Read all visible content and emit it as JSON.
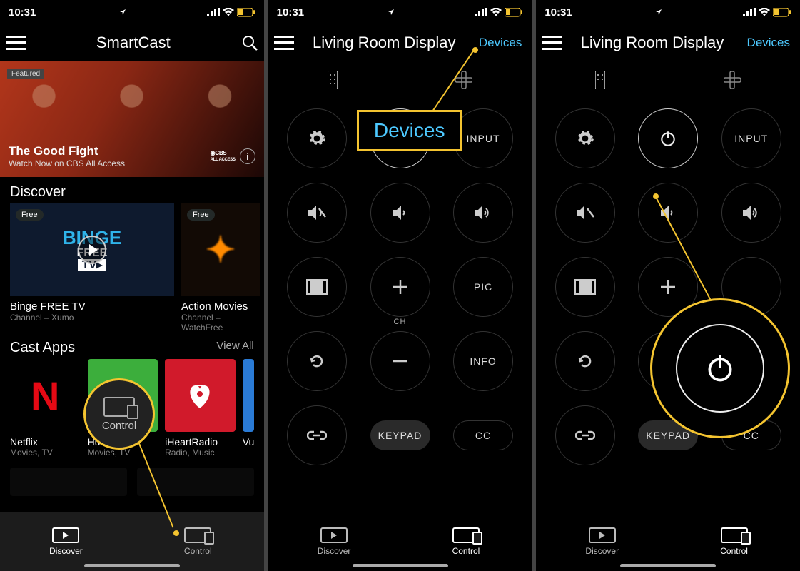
{
  "status": {
    "time": "10:31",
    "battery_low": true
  },
  "screen1": {
    "title": "SmartCast",
    "hero": {
      "badge": "Featured",
      "title": "The Good Fight",
      "subtitle": "Watch Now on CBS All Access",
      "network": "CBS ALL ACCESS"
    },
    "discover": {
      "heading": "Discover",
      "items": [
        {
          "badge": "Free",
          "title": "Binge FREE TV",
          "sub": "Channel – Xumo"
        },
        {
          "badge": "Free",
          "title": "Action Movies",
          "sub": "Channel – WatchFree"
        }
      ]
    },
    "castapps": {
      "heading": "Cast Apps",
      "viewall": "View All",
      "items": [
        {
          "name": "Netflix",
          "sub": "Movies, TV"
        },
        {
          "name": "Hulu",
          "sub": "Movies, TV"
        },
        {
          "name": "iHeartRadio",
          "sub": "Radio, Music"
        },
        {
          "name": "Vu",
          "sub": ""
        }
      ]
    },
    "tabs": {
      "discover": "Discover",
      "control": "Control"
    },
    "callout_label": "Control"
  },
  "remote": {
    "title": "Living Room Display",
    "devices": "Devices",
    "buttons": {
      "input": "INPUT",
      "pic": "PIC",
      "info": "INFO",
      "keypad": "KEYPAD",
      "cc": "CC",
      "ch": "CH"
    },
    "tabs": {
      "discover": "Discover",
      "control": "Control"
    },
    "callout_devices": "Devices"
  },
  "colors": {
    "accent": "#4dc9ff",
    "highlight": "#f4c430"
  }
}
